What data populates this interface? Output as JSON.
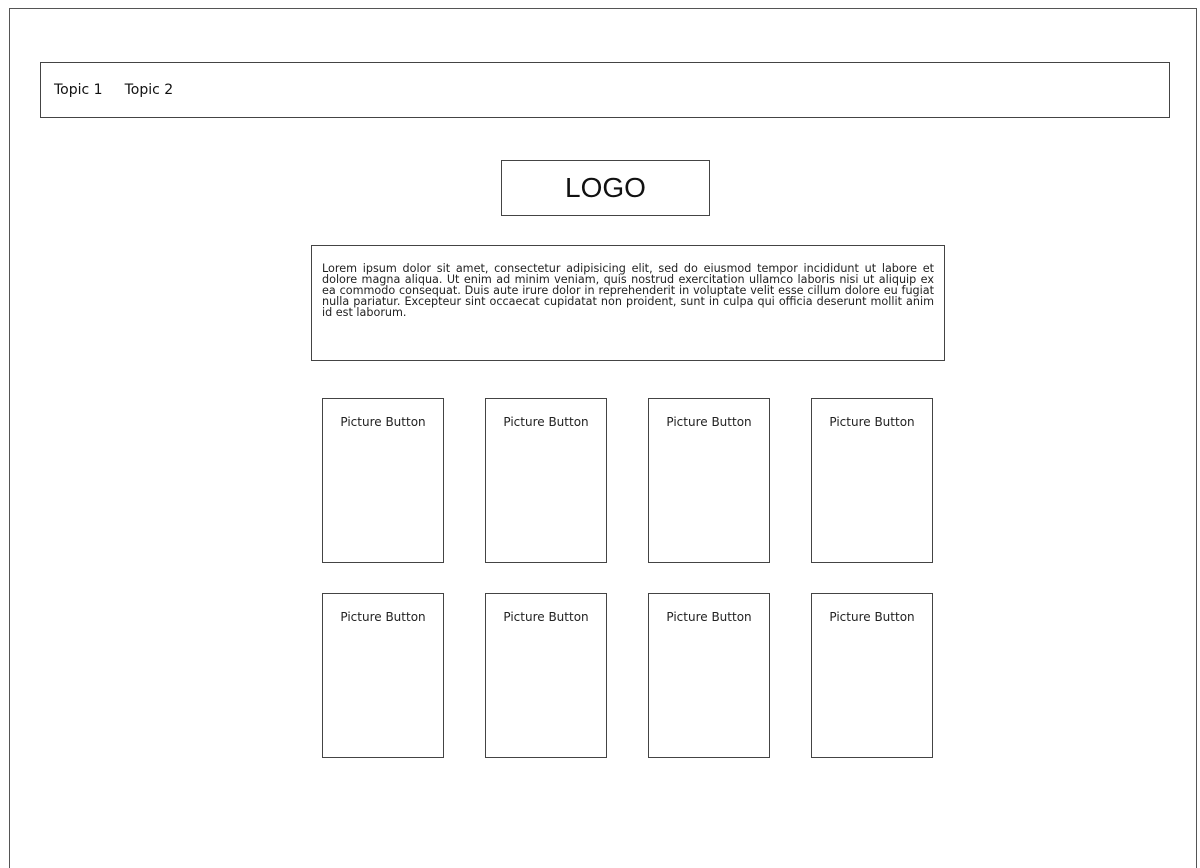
{
  "nav": {
    "items": [
      "Topic 1",
      "Topic 2"
    ]
  },
  "logo": {
    "label": "LOGO"
  },
  "intro": {
    "text": "Lorem ipsum dolor sit amet, consectetur adipisicing elit, sed do eiusmod tempor incididunt ut labore et dolore magna aliqua. Ut enim ad minim veniam, quis nostrud exercitation ullamco laboris nisi ut aliquip ex ea commodo consequat. Duis aute irure dolor in reprehenderit in voluptate velit esse cillum dolore eu fugiat nulla pariatur. Excepteur sint occaecat cupidatat non proident, sunt in culpa qui officia deserunt mollit anim id est laborum."
  },
  "picture_buttons": [
    "Picture Button",
    "Picture Button",
    "Picture Button",
    "Picture Button",
    "Picture Button",
    "Picture Button",
    "Picture Button",
    "Picture Button"
  ]
}
